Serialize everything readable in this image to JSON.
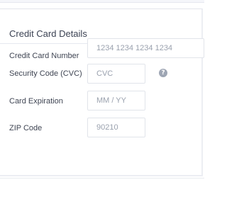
{
  "form": {
    "title": "Credit Card Details",
    "fields": {
      "card_number": {
        "label": "Credit Card Number",
        "placeholder": "1234 1234 1234 1234",
        "value": ""
      },
      "security_code": {
        "label": "Security Code (CVC)",
        "placeholder": "CVC",
        "value": ""
      },
      "expiration": {
        "label": "Card Expiration",
        "placeholder": "MM / YY",
        "value": ""
      },
      "zip": {
        "label": "ZIP Code",
        "placeholder": "90210",
        "value": ""
      }
    },
    "help_icon": {
      "name": "question-icon",
      "glyph": "?"
    }
  },
  "colors": {
    "text": "#3b4253",
    "placeholder": "#9aa1ae",
    "border": "#e1e4ea",
    "help_icon_bg": "#9ea6b4"
  }
}
